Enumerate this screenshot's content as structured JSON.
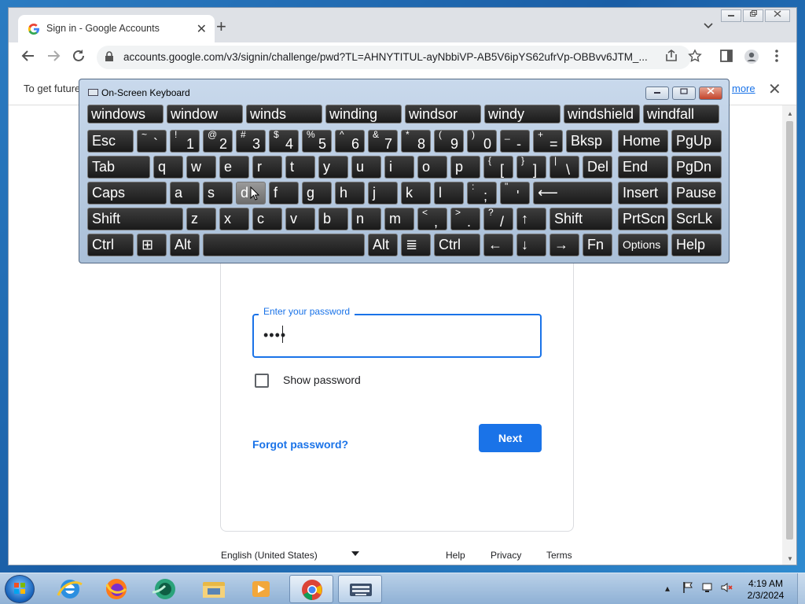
{
  "browser": {
    "tab_title": "Sign in - Google Accounts",
    "tab_close": "✕",
    "new_tab": "+",
    "tab_menu": "⌄",
    "window_buttons": [
      "▭",
      "⧉",
      "✕"
    ],
    "url": "accounts.google.com/v3/signin/challenge/pwd?TL=AHNYTITUL-ayNbbiVP-AB5V6ipYS62ufrVp-OBBvv6JTM_...",
    "infobar_text": "To get future",
    "infobar_link": "more",
    "infobar_close": "✕"
  },
  "signin": {
    "password_label": "Enter your password",
    "password_value": "••••",
    "show_password_label": "Show password",
    "forgot_label": "Forgot password?",
    "next_label": "Next",
    "language": "English (United States)",
    "footer_links": [
      "Help",
      "Privacy",
      "Terms"
    ]
  },
  "osk": {
    "title": "On-Screen Keyboard",
    "suggestions": [
      "windows",
      "window",
      "winds",
      "winding",
      "windsor",
      "windy",
      "windshield",
      "windfall"
    ],
    "row1": [
      {
        "m": "Esc"
      },
      {
        "s": "~",
        "m": "`"
      },
      {
        "s": "!",
        "m": "1"
      },
      {
        "s": "@",
        "m": "2"
      },
      {
        "s": "#",
        "m": "3"
      },
      {
        "s": "$",
        "m": "4"
      },
      {
        "s": "%",
        "m": "5"
      },
      {
        "s": "^",
        "m": "6"
      },
      {
        "s": "&",
        "m": "7"
      },
      {
        "s": "*",
        "m": "8"
      },
      {
        "s": "(",
        "m": "9"
      },
      {
        "s": ")",
        "m": "0"
      },
      {
        "s": "_",
        "m": "-"
      },
      {
        "s": "+",
        "m": "="
      },
      {
        "m": "Bksp"
      },
      {
        "m": "Home"
      },
      {
        "m": "PgUp"
      }
    ],
    "row2": [
      {
        "m": "Tab"
      },
      {
        "m": "q"
      },
      {
        "m": "w"
      },
      {
        "m": "e"
      },
      {
        "m": "r"
      },
      {
        "m": "t"
      },
      {
        "m": "y"
      },
      {
        "m": "u"
      },
      {
        "m": "i"
      },
      {
        "m": "o"
      },
      {
        "m": "p"
      },
      {
        "s": "{",
        "m": "["
      },
      {
        "s": "}",
        "m": "]"
      },
      {
        "s": "|",
        "m": "\\"
      },
      {
        "m": "Del"
      },
      {
        "m": "End"
      },
      {
        "m": "PgDn"
      }
    ],
    "row3": [
      {
        "m": "Caps"
      },
      {
        "m": "a"
      },
      {
        "m": "s"
      },
      {
        "m": "d"
      },
      {
        "m": "f"
      },
      {
        "m": "g"
      },
      {
        "m": "h"
      },
      {
        "m": "j"
      },
      {
        "m": "k"
      },
      {
        "m": "l"
      },
      {
        "s": ":",
        "m": ";"
      },
      {
        "s": "\"",
        "m": "'"
      },
      {
        "m": "⟵"
      },
      {
        "m": "Insert"
      },
      {
        "m": "Pause"
      }
    ],
    "row4": [
      {
        "m": "Shift"
      },
      {
        "m": "z"
      },
      {
        "m": "x"
      },
      {
        "m": "c"
      },
      {
        "m": "v"
      },
      {
        "m": "b"
      },
      {
        "m": "n"
      },
      {
        "m": "m"
      },
      {
        "s": "<",
        "m": ","
      },
      {
        "s": ">",
        "m": "."
      },
      {
        "s": "?",
        "m": "/"
      },
      {
        "m": "↑"
      },
      {
        "m": "Shift"
      },
      {
        "m": "PrtScn"
      },
      {
        "m": "ScrLk"
      }
    ],
    "row5": [
      {
        "m": "Ctrl"
      },
      {
        "m": "⊞"
      },
      {
        "m": "Alt"
      },
      {
        "m": ""
      },
      {
        "m": "Alt"
      },
      {
        "m": "≣"
      },
      {
        "m": "Ctrl"
      },
      {
        "m": "←"
      },
      {
        "m": "↓"
      },
      {
        "m": "→"
      },
      {
        "m": "Fn"
      },
      {
        "m": "Options"
      },
      {
        "m": "Help"
      }
    ],
    "pressed_key": "d"
  },
  "taskbar": {
    "time": "4:19 AM",
    "date": "2/3/2024",
    "tray_arrow": "▴"
  }
}
